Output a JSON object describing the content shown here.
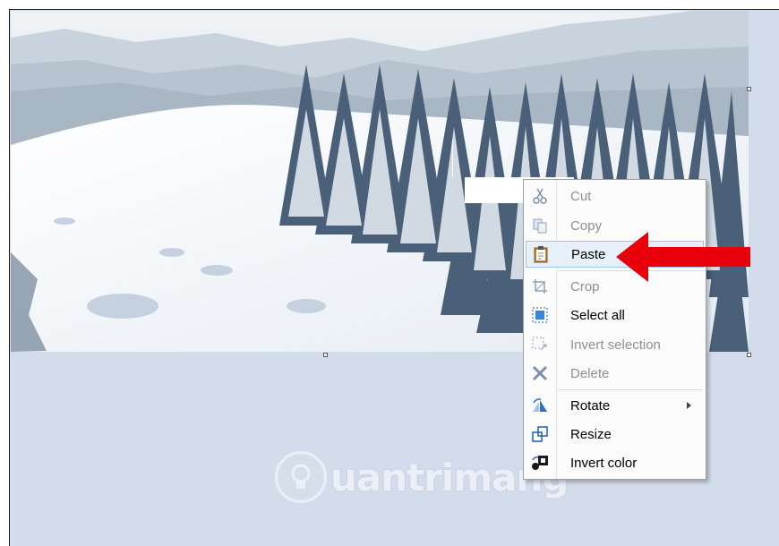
{
  "context_menu": {
    "items": [
      {
        "name": "cut",
        "label": "Cut",
        "icon": "scissors-icon",
        "enabled": false
      },
      {
        "name": "copy",
        "label": "Copy",
        "icon": "copy-icon",
        "enabled": false
      },
      {
        "name": "paste",
        "label": "Paste",
        "icon": "clipboard-icon",
        "enabled": true,
        "highlighted": true
      },
      {
        "name": "crop",
        "label": "Crop",
        "icon": "crop-icon",
        "enabled": false
      },
      {
        "name": "select-all",
        "label": "Select all",
        "icon": "select-all-icon",
        "enabled": true
      },
      {
        "name": "invert-selection",
        "label": "Invert selection",
        "icon": "invert-selection-icon",
        "enabled": false
      },
      {
        "name": "delete",
        "label": "Delete",
        "icon": "delete-x-icon",
        "enabled": false
      },
      {
        "name": "rotate",
        "label": "Rotate",
        "icon": "rotate-icon",
        "enabled": true,
        "submenu": true
      },
      {
        "name": "resize",
        "label": "Resize",
        "icon": "resize-icon",
        "enabled": true
      },
      {
        "name": "invert-color",
        "label": "Invert color",
        "icon": "invert-color-icon",
        "enabled": true
      }
    ]
  },
  "watermark": {
    "text": "uantrimang"
  },
  "colors": {
    "canvas_background": "#d3dceb",
    "arrow": "#e8000b",
    "menu_hover": "#e7f0fa"
  }
}
